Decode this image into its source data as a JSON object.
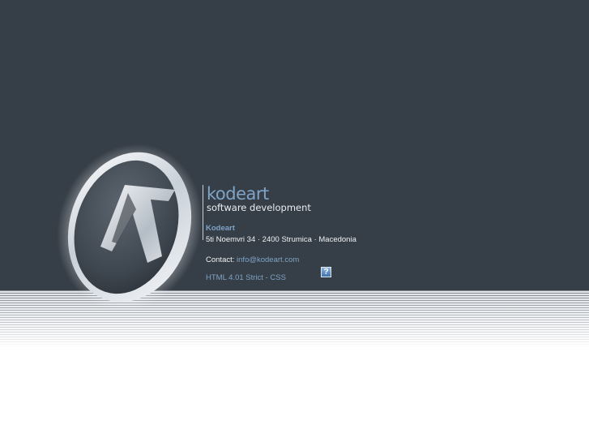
{
  "brand": {
    "name": "kodeart",
    "tagline": "software development"
  },
  "info": {
    "company": "Kodeart",
    "address": "5ti Noemvri 34 · 2400 Strumica · Macedonia",
    "contact_label": "Contact:",
    "email": "info@kodeart.com",
    "html_link": "HTML 4.01 Strict",
    "separator": "-",
    "css_link": "CSS"
  },
  "help": {
    "icon": "help-icon",
    "glyph": "?"
  },
  "colors": {
    "panel": "#363e47",
    "accent": "#7fa4c6",
    "text": "#f0f3f5"
  }
}
